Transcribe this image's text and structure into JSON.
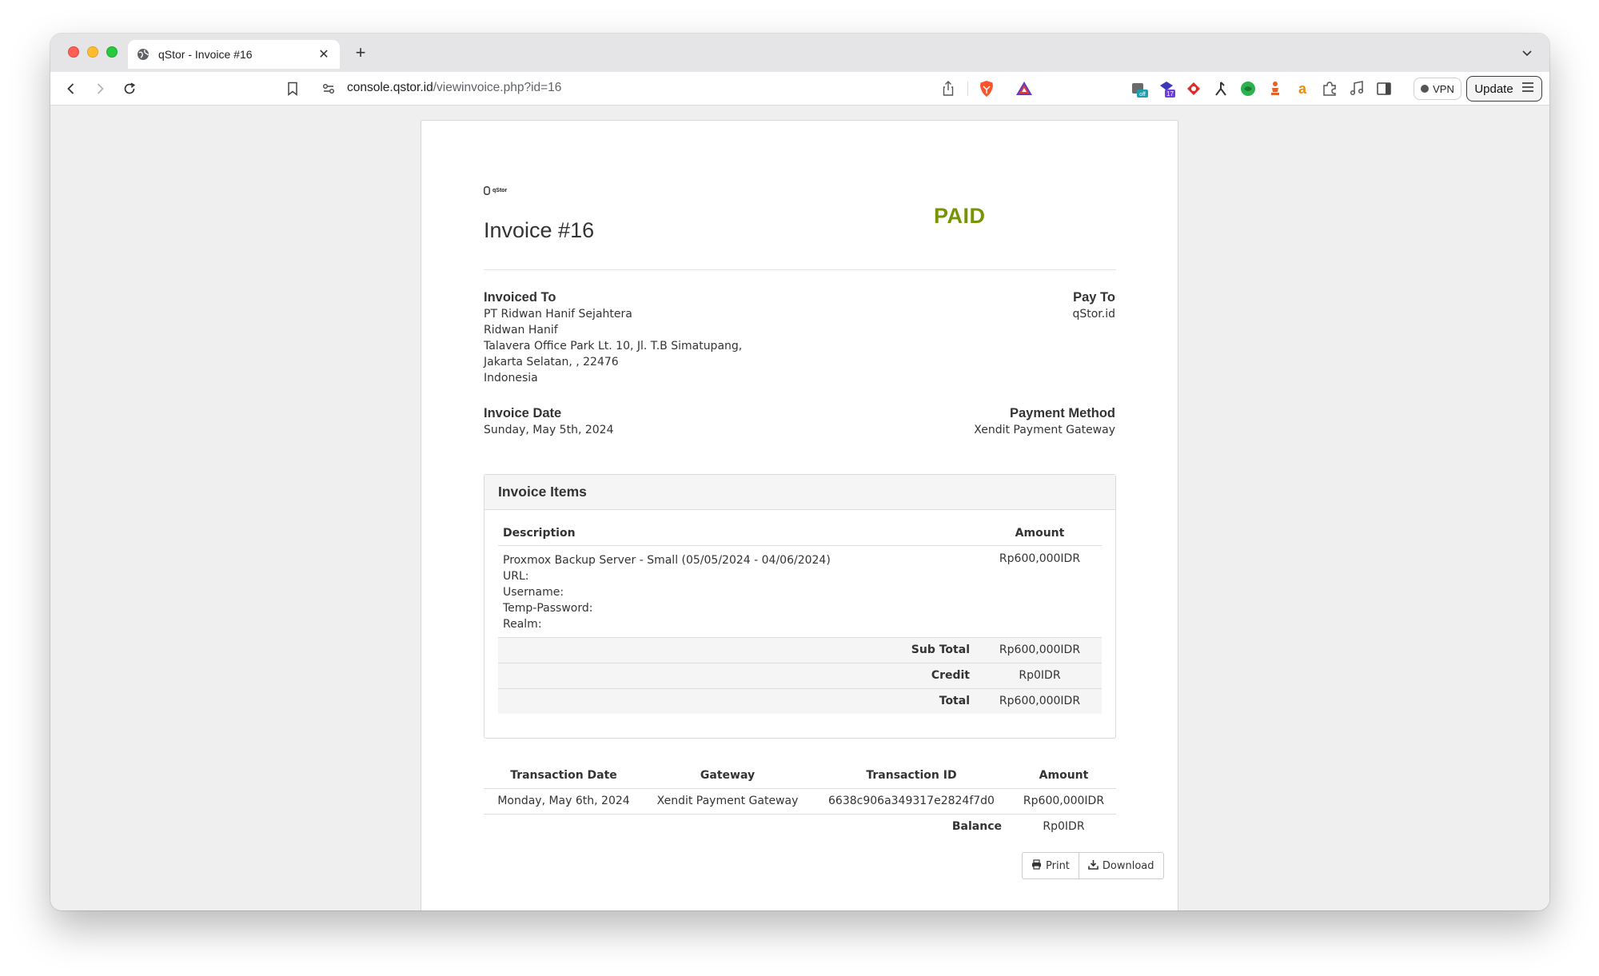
{
  "browser": {
    "tab_title": "qStor - Invoice #16",
    "url_host": "console.qstor.id",
    "url_path": "/viewinvoice.php?id=16",
    "extension_badge_off": "off",
    "extension_badge_count": "17",
    "vpn_label": "VPN",
    "update_label": "Update"
  },
  "invoice": {
    "logo_text": "qStor",
    "title": "Invoice #16",
    "status": "PAID",
    "status_color": "#779500",
    "invoiced_to": {
      "label": "Invoiced To",
      "lines": [
        "PT Ridwan Hanif Sejahtera",
        "Ridwan Hanif",
        "Talavera Office Park Lt. 10, Jl. T.B Simatupang,",
        "Jakarta Selatan, , 22476",
        "Indonesia"
      ]
    },
    "pay_to": {
      "label": "Pay To",
      "lines": [
        "qStor.id"
      ]
    },
    "invoice_date": {
      "label": "Invoice Date",
      "value": "Sunday, May 5th, 2024"
    },
    "payment_method": {
      "label": "Payment Method",
      "value": "Xendit Payment Gateway"
    },
    "items": {
      "panel_title": "Invoice Items",
      "headers": {
        "description": "Description",
        "amount": "Amount"
      },
      "rows": [
        {
          "description_lines": [
            "Proxmox Backup Server - Small (05/05/2024 - 04/06/2024)",
            "URL:",
            "Username:",
            "Temp-Password:",
            "Realm:"
          ],
          "amount": "Rp600,000IDR"
        }
      ],
      "summary": [
        {
          "label": "Sub Total",
          "value": "Rp600,000IDR"
        },
        {
          "label": "Credit",
          "value": "Rp0IDR"
        },
        {
          "label": "Total",
          "value": "Rp600,000IDR"
        }
      ]
    },
    "transactions": {
      "headers": [
        "Transaction Date",
        "Gateway",
        "Transaction ID",
        "Amount"
      ],
      "rows": [
        [
          "Monday, May 6th, 2024",
          "Xendit Payment Gateway",
          "6638c906a349317e2824f7d0",
          "Rp600,000IDR"
        ]
      ],
      "balance_label": "Balance",
      "balance_value": "Rp0IDR"
    },
    "actions": {
      "print_label": "Print",
      "download_label": "Download"
    }
  }
}
